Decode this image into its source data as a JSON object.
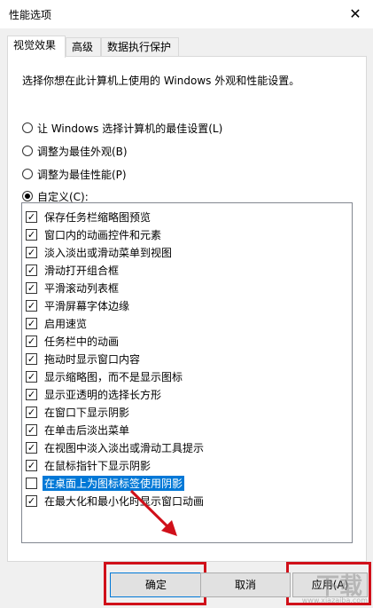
{
  "window": {
    "title": "性能选项",
    "close_label": "✕"
  },
  "tabs": [
    {
      "label": "视觉效果"
    },
    {
      "label": "高级"
    },
    {
      "label": "数据执行保护"
    }
  ],
  "panel": {
    "description": "选择你想在此计算机上使用的 Windows 外观和性能设置。",
    "radios": [
      {
        "label": "让 Windows 选择计算机的最佳设置(L)",
        "checked": false
      },
      {
        "label": "调整为最佳外观(B)",
        "checked": false
      },
      {
        "label": "调整为最佳性能(P)",
        "checked": false
      },
      {
        "label": "自定义(C):",
        "checked": true
      }
    ],
    "options": [
      {
        "label": "保存任务栏缩略图预览",
        "checked": true
      },
      {
        "label": "窗口内的动画控件和元素",
        "checked": true
      },
      {
        "label": "淡入淡出或滑动菜单到视图",
        "checked": true
      },
      {
        "label": "滑动打开组合框",
        "checked": true
      },
      {
        "label": "平滑滚动列表框",
        "checked": true
      },
      {
        "label": "平滑屏幕字体边缘",
        "checked": true
      },
      {
        "label": "启用速览",
        "checked": true
      },
      {
        "label": "任务栏中的动画",
        "checked": true
      },
      {
        "label": "拖动时显示窗口内容",
        "checked": true
      },
      {
        "label": "显示缩略图，而不是显示图标",
        "checked": true
      },
      {
        "label": "显示亚透明的选择长方形",
        "checked": true
      },
      {
        "label": "在窗口下显示阴影",
        "checked": true
      },
      {
        "label": "在单击后淡出菜单",
        "checked": true
      },
      {
        "label": "在视图中淡入淡出或滑动工具提示",
        "checked": true
      },
      {
        "label": "在鼠标指针下显示阴影",
        "checked": true
      },
      {
        "label": "在桌面上为图标标签使用阴影",
        "checked": false,
        "selected": true
      },
      {
        "label": "在最大化和最小化时显示窗口动画",
        "checked": true
      }
    ]
  },
  "buttons": {
    "ok": "确定",
    "cancel": "取消",
    "apply": "应用(A)"
  },
  "watermark": {
    "text": "下载",
    "small": "www.xiazaiba.com"
  },
  "colors": {
    "highlight_box": "#d0101a",
    "selection": "#0078d7",
    "arrow": "#d0101a"
  }
}
